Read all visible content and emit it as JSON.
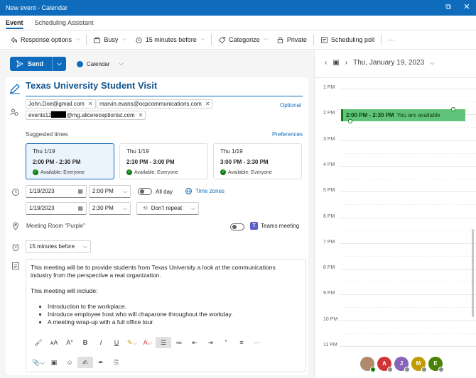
{
  "window": {
    "title": "New event - Calendar"
  },
  "tabs": [
    {
      "label": "Event",
      "active": true
    },
    {
      "label": "Scheduling Assistant",
      "active": false
    }
  ],
  "ribbon": {
    "response_options": "Response options",
    "busy": "Busy",
    "reminder": "15 minutes before",
    "categorize": "Categorize",
    "private": "Private",
    "scheduling_poll": "Scheduling poll",
    "more": "···"
  },
  "send": {
    "label": "Send"
  },
  "calendar_selector": {
    "label": "Calendar",
    "color": "#0f6cbd"
  },
  "event": {
    "title": "Texas University Student Visit",
    "attendees": [
      "John.Doe@gmail.com",
      "marvin.evans@ocpcommunications.com"
    ],
    "attendee3_prefix": "events12",
    "attendee3_suffix": "@mg.alicereceptionist.com",
    "optional_label": "Optional"
  },
  "suggested": {
    "label": "Suggested times",
    "preferences_label": "Preferences",
    "cards": [
      {
        "date": "Thu 1/19",
        "time": "2:00 PM - 2:30 PM",
        "availability": "Available: Everyone",
        "selected": true
      },
      {
        "date": "Thu 1/19",
        "time": "2:30 PM - 3:00 PM",
        "availability": "Available: Everyone",
        "selected": false
      },
      {
        "date": "Thu 1/19",
        "time": "3:00 PM - 3:30 PM",
        "availability": "Available: Everyone",
        "selected": false
      }
    ]
  },
  "datetime": {
    "start_date": "1/19/2023",
    "start_time": "2:00 PM",
    "end_date": "1/19/2023",
    "end_time": "2:30 PM",
    "all_day_label": "All day",
    "time_zones_label": "Time zones",
    "repeat_label": "Don't repeat"
  },
  "location": {
    "placeholder": "Meeting Room \"Purple\"",
    "teams_label": "Teams meeting"
  },
  "reminder_field": {
    "value": "15 minutes before"
  },
  "body": {
    "paragraph1": "This meeting will be to provide students from Texas University a look at the communications industry from the perspective a real organization.",
    "paragraph2": "This meeting will include:",
    "bullets": [
      "Introduction to the workplace.",
      "Introduce employee host who will chaparone throughout the workday.",
      "A meeting wrap-up with a full office tour."
    ]
  },
  "day_view": {
    "date": "Thu, January 19, 2023",
    "hours": [
      "1 PM",
      "2 PM",
      "3 PM",
      "4 PM",
      "5 PM",
      "6 PM",
      "7 PM",
      "8 PM",
      "9 PM",
      "10 PM",
      "11 PM"
    ],
    "event_time": "2:00 PM - 2:30 PM",
    "event_note": "You are available",
    "event_color": "#5fc37a"
  },
  "avatars": [
    {
      "initial": "",
      "color": "#b08a6b",
      "status": "ok"
    },
    {
      "initial": "A",
      "color": "#d13438",
      "status": "unknown"
    },
    {
      "initial": "J",
      "color": "#8764b8",
      "status": "unknown"
    },
    {
      "initial": "M",
      "color": "#c19c00",
      "status": "unknown"
    },
    {
      "initial": "E",
      "color": "#498205",
      "status": "unknown"
    }
  ]
}
